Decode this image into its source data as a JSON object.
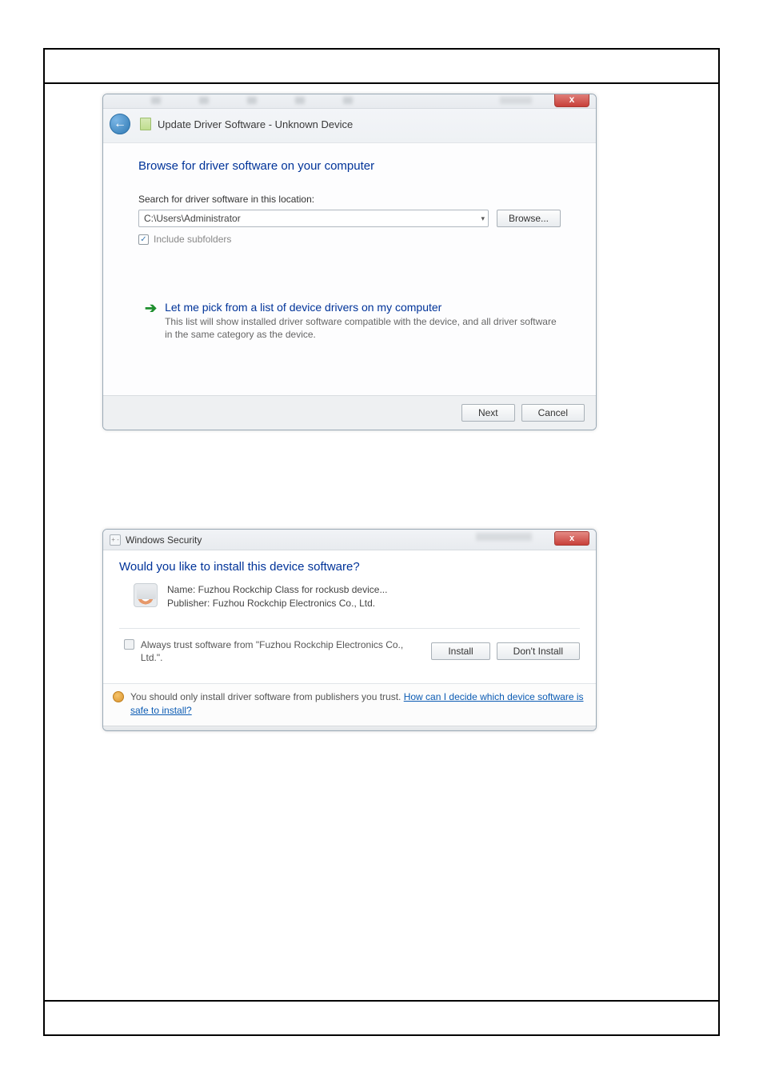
{
  "dialog1": {
    "header_text": "Update Driver Software - Unknown Device",
    "close_glyph": "x",
    "back_glyph": "←",
    "heading": "Browse for driver software on your computer",
    "search_label": "Search for driver software in this location:",
    "path_value": "C:\\Users\\Administrator",
    "browse_label": "Browse...",
    "include_label": "Include subfolders",
    "include_check": "✓",
    "option_title": "Let me pick from a list of device drivers on my computer",
    "option_desc": "This list will show installed driver software compatible with the device, and all driver software in the same category as the device.",
    "next_label": "Next",
    "cancel_label": "Cancel"
  },
  "dialog2": {
    "title": "Windows Security",
    "close_glyph": "x",
    "icon_glyph": "+ -",
    "heading": "Would you like to install this device software?",
    "name_line": "Name: Fuzhou Rockchip Class for rockusb device...",
    "publisher_line": "Publisher: Fuzhou Rockchip Electronics Co., Ltd.",
    "trust_text": "Always trust software from \"Fuzhou Rockchip Electronics Co., Ltd.\".",
    "install_label": "Install",
    "dont_install_label": "Don't Install",
    "warn_prefix": "You should only install driver software from publishers you trust.  ",
    "warn_link": "How can I decide which device software is safe to install?"
  }
}
